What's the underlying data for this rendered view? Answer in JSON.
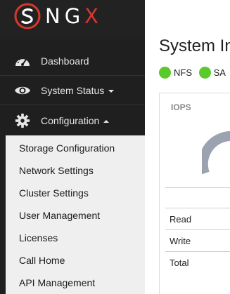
{
  "brand": {
    "text_main": "NG",
    "text_accent": "X",
    "accent_color": "#d8382a"
  },
  "sidebar": {
    "items": [
      {
        "label": "Dashboard",
        "icon": "tachometer-icon"
      },
      {
        "label": "System Status",
        "icon": "eye-icon",
        "caret": "down"
      },
      {
        "label": "Configuration",
        "icon": "gear-icon",
        "caret": "up"
      }
    ],
    "submenu": [
      "Storage Configuration",
      "Network Settings",
      "Cluster Settings",
      "User Management",
      "Licenses",
      "Call Home",
      "API Management"
    ]
  },
  "main": {
    "title": "System In",
    "status": [
      {
        "label": "NFS",
        "color": "#5ac92b"
      },
      {
        "label": "SA",
        "color": "#5ac92b"
      }
    ],
    "panel": {
      "title": "IOPS",
      "rows": [
        "Read",
        "Write",
        "Total"
      ]
    }
  }
}
